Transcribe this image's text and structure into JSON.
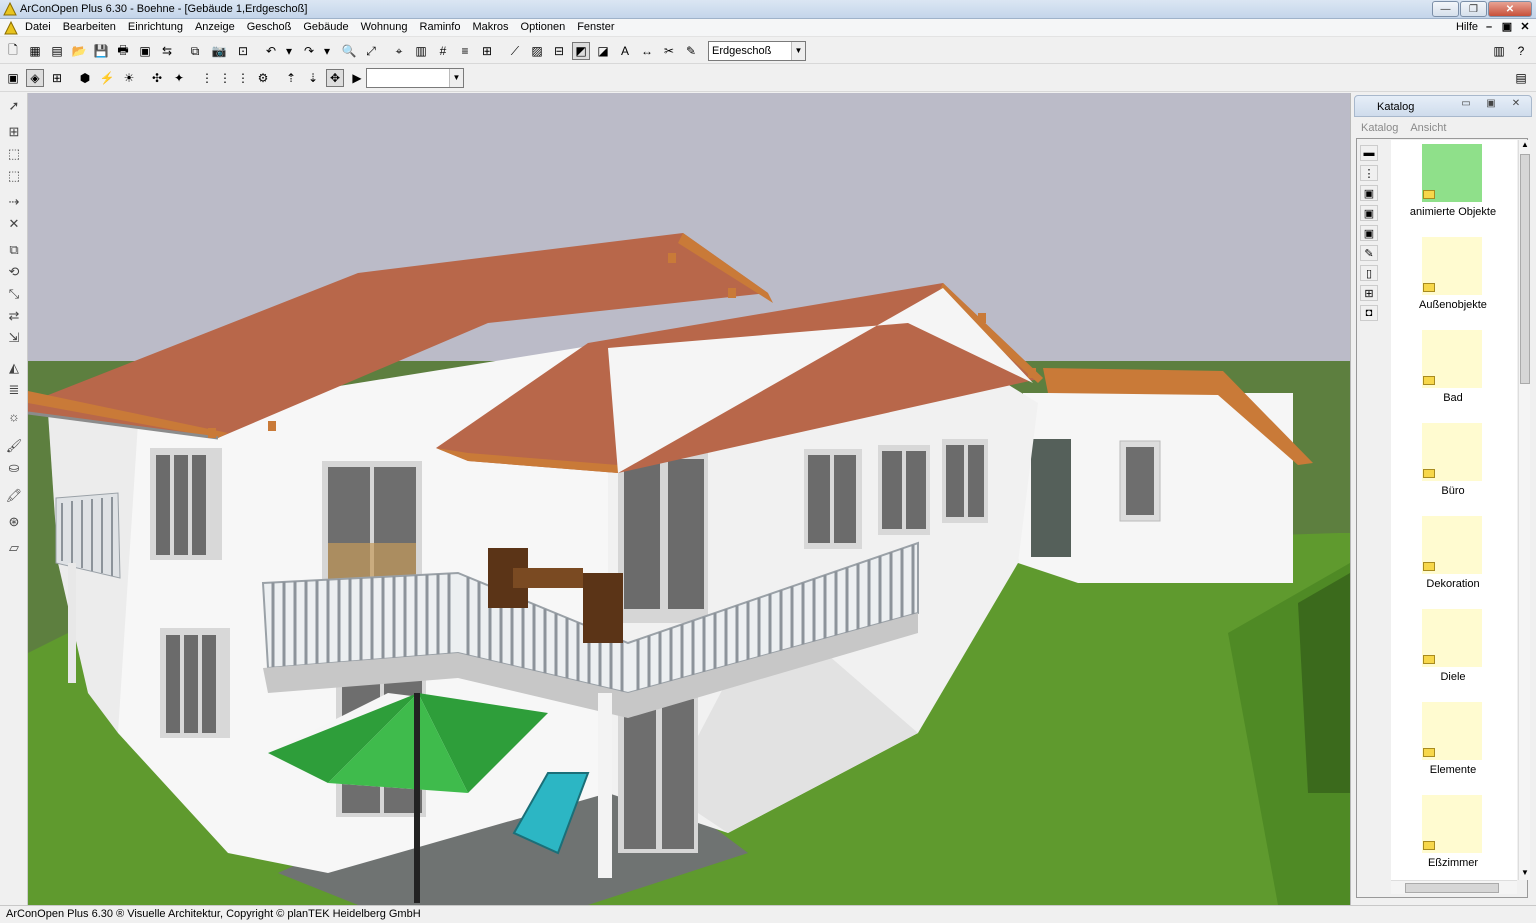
{
  "window": {
    "title": "ArConOpen Plus  6.30 - Boehne - [Gebäude 1,Erdgeschoß]",
    "min_icon": "minimize-icon",
    "max_icon": "maximize-icon",
    "close_icon": "close-icon"
  },
  "menubar": {
    "items": [
      "Datei",
      "Bearbeiten",
      "Einrichtung",
      "Anzeige",
      "Geschoß",
      "Gebäude",
      "Wohnung",
      "Raminfo",
      "Makros",
      "Optionen",
      "Fenster"
    ],
    "help": "Hilfe"
  },
  "toolbar": {
    "floor_combo_value": "Erdgeschoß",
    "second_combo_value": ""
  },
  "catalog": {
    "title": "Katalog",
    "menu": [
      "Katalog",
      "Ansicht"
    ],
    "items": [
      {
        "label": "animierte Objekte"
      },
      {
        "label": "Außenobjekte"
      },
      {
        "label": "Bad"
      },
      {
        "label": "Büro"
      },
      {
        "label": "Dekoration"
      },
      {
        "label": "Diele"
      },
      {
        "label": "Elemente"
      },
      {
        "label": "Eßzimmer"
      }
    ]
  },
  "statusbar": {
    "text": "ArConOpen Plus 6.30 ® Visuelle Architektur, Copyright © planTEK Heidelberg GmbH"
  },
  "colors": {
    "sky": "#bbbbc8",
    "grass": "#5f9a2e",
    "roof": "#b8674a",
    "wall": "#f4f4f4",
    "umbrella_green": "#2e9e3a"
  }
}
